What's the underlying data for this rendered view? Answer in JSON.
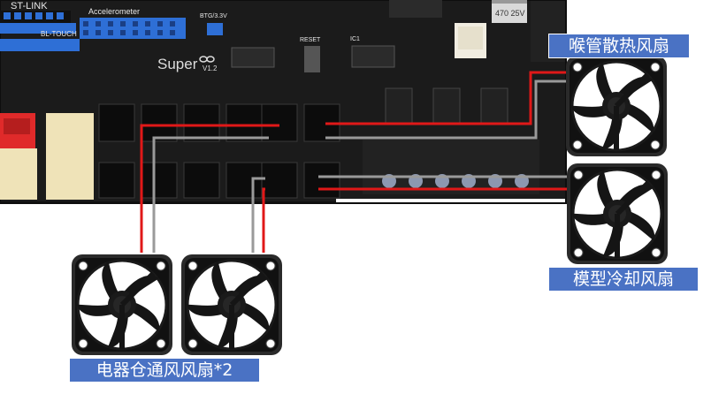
{
  "board": {
    "silkscreen": {
      "st_link": "ST-LINK",
      "accelerometer": "Accelerometer",
      "bl_touch": "BL-TOUCH",
      "voltage_select": "BTG/3.3V",
      "reset": "RESET",
      "ic": "IC1",
      "logo": "Super",
      "version": "V1.2",
      "capacitor": "470 25V"
    },
    "colors": {
      "pcb": "#1c1c1c",
      "header_blue": "#2e6fd6",
      "connector_cream": "#efe3b8",
      "connector_red": "#e02a2a",
      "wire_red": "#e01818",
      "wire_gray": "#9a9a9a"
    }
  },
  "labels": {
    "throat_fan": "喉管散热风扇",
    "model_fan": "模型冷却风扇",
    "electronics_fan": "电器仓通风风扇*2"
  }
}
